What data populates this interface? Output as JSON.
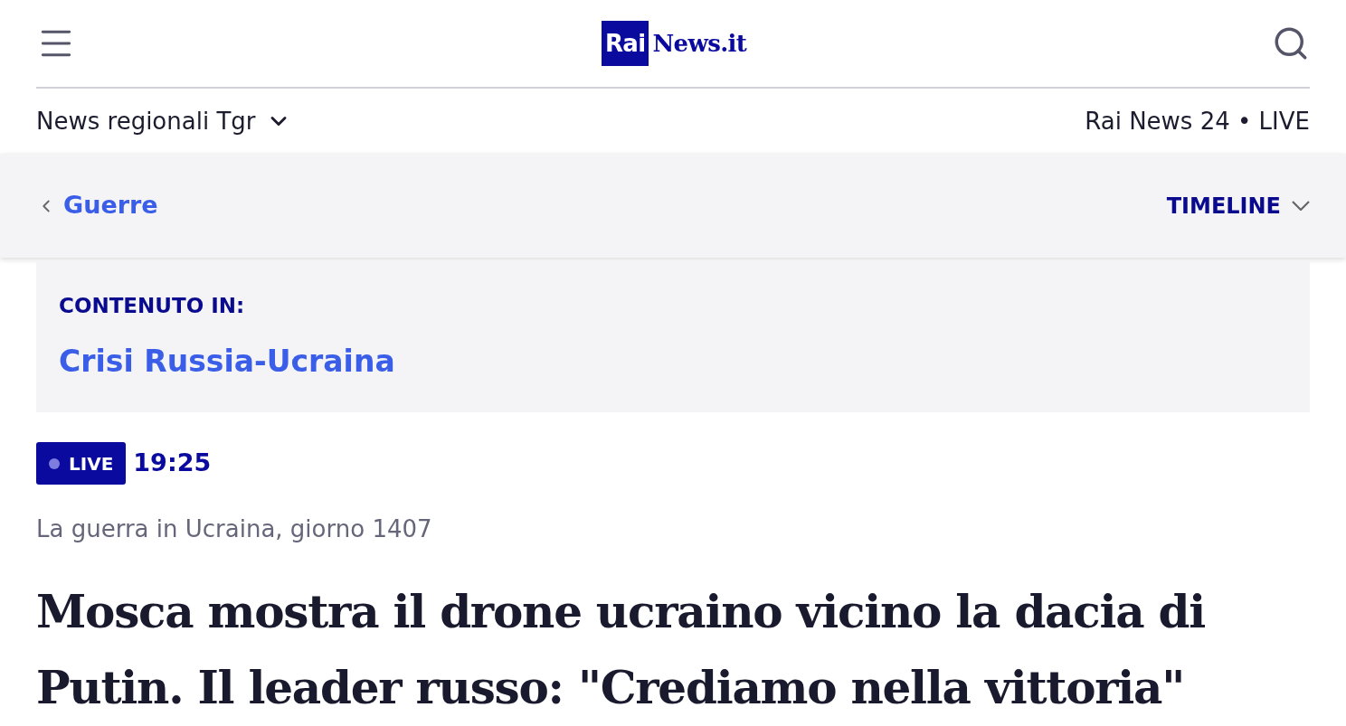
{
  "logo": {
    "box": "Rai",
    "text": "News.it"
  },
  "subnav": {
    "left": "News regionali Tgr",
    "right": "Rai News 24 • LIVE"
  },
  "breadcrumb": {
    "back": "Guerre",
    "timeline": "TIMELINE"
  },
  "contained_in": {
    "label": "CONTENUTO IN:",
    "link": "Crisi Russia-Ucraina"
  },
  "live": {
    "badge": "LIVE",
    "time": "19:25"
  },
  "kicker": "La guerra in Ucraina, giorno 1407",
  "headline": "Mosca mostra il drone ucraino vicino la dacia di Putin. Il leader russo: \"Crediamo nella vittoria\""
}
